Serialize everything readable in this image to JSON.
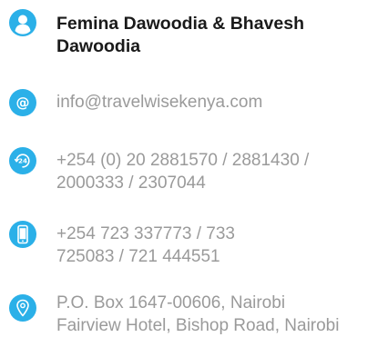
{
  "contact": {
    "name_lines": [
      "Femina Dawoodia & Bhavesh",
      "Dawoodia"
    ],
    "email": "info@travelwisekenya.com",
    "phone_lines": [
      "+254 (0) 20 2881570 / 2881430 /",
      "2000333 / 2307044"
    ],
    "mobile_lines": [
      "+254 723 337773 / 733",
      "725083 / 721 444551"
    ],
    "address_lines": [
      "P.O. Box 1647-00606, Nairobi",
      "Fairview Hotel, Bishop Road, Nairobi"
    ]
  },
  "icons": {
    "person": "person-icon",
    "email": "at-sign-icon",
    "phone": "24h-phone-icon",
    "mobile": "mobile-phone-icon",
    "address": "location-pin-icon"
  },
  "colors": {
    "accent": "#2bb0e8",
    "name_text": "#1a1a1a",
    "body_text": "#9a9a9a",
    "background": "#ffffff"
  }
}
